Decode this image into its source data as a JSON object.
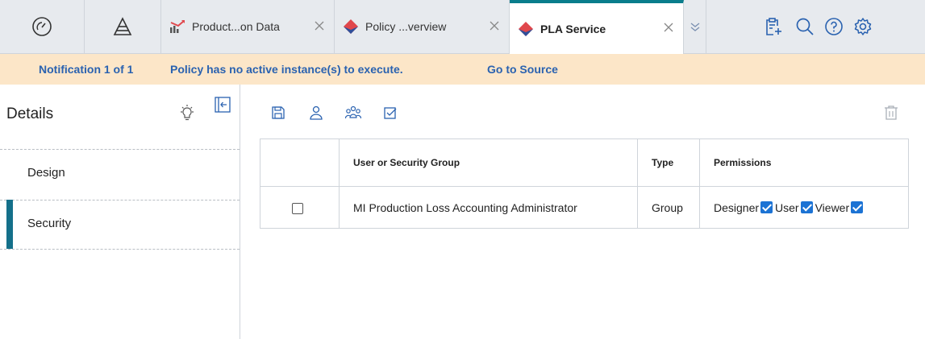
{
  "tabs": [
    {
      "label": "Product...on Data",
      "icon": "production-chart-icon",
      "color": "#e0474c"
    },
    {
      "label": "Policy ...verview",
      "icon": "policy-diamond-icon",
      "color": "#e0474c"
    },
    {
      "label": "PLA Service",
      "icon": "policy-diamond-icon",
      "color": "#e0474c",
      "active": true
    }
  ],
  "notification": {
    "counter": "Notification 1 of 1",
    "message": "Policy has no active instance(s) to execute.",
    "link": "Go to Source"
  },
  "side": {
    "title": "Details",
    "items": [
      {
        "label": "Design"
      },
      {
        "label": "Security",
        "selected": true
      }
    ]
  },
  "table": {
    "headers": [
      "User or Security Group",
      "Type",
      "Permissions"
    ],
    "rows": [
      {
        "checked": false,
        "group": "MI Production Loss Accounting Administrator",
        "type": "Group",
        "permissions": [
          {
            "label": "Designer",
            "checked": true
          },
          {
            "label": "User",
            "checked": true
          },
          {
            "label": "Viewer",
            "checked": true
          }
        ]
      }
    ]
  },
  "colors": {
    "accent": "#0a7d8c",
    "notification_bg": "#fce6c8",
    "notification_text": "#2a62b0",
    "checkbox_blue": "#1c73d4",
    "tab_icon_red": "#e0474c"
  }
}
